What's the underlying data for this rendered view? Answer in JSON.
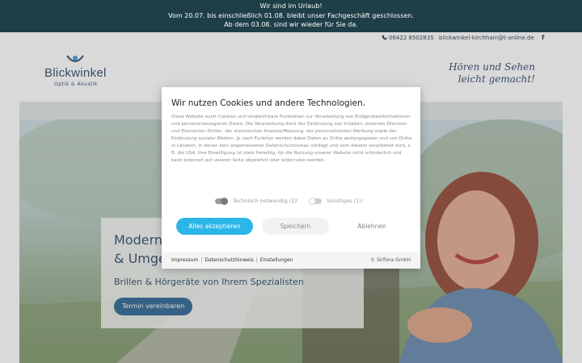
{
  "announcement": {
    "line1": "Wir sind im Urlaub!",
    "line2": "Vom 20.07. bis einschließlich 01.08. bleibt unser Fachgeschäft geschlossen.",
    "line3": "Ab dem 03.08. sind wir wieder für Sie da."
  },
  "contact": {
    "phone": "06422 8502835",
    "phone_icon": "phone-icon",
    "email": "blickwinkel-kirchhain@t-online.de",
    "facebook_icon": "facebook-icon",
    "facebook_glyph": "f"
  },
  "header": {
    "logo_title": "Blickwinkel",
    "logo_subtitle": "Optik & Akustik",
    "tagline_line1": "Hören und Sehen",
    "tagline_line2": "leicht gemacht!"
  },
  "hero": {
    "title_line1": "Moderns",
    "title_line2": "& Umge",
    "subtitle": "Brillen & Hörgeräte von Ihrem Spezialisten",
    "cta_label": "Termin vereinbaren"
  },
  "cookie_dialog": {
    "title": "Wir nutzen Cookies und andere Technologien.",
    "body": "Diese Website nutzt Cookies und vergleichbare Funktionen zur Verarbeitung von Endgeräteinformationen und personenbezogenen Daten. Die Verarbeitung dient der Einbindung von Inhalten, externen Diensten und Elementen Dritter, der statistischen Analyse/Messung, der personalisierten Werbung sowie der Einbindung sozialer Medien. Je nach Funktion werden dabei Daten an Dritte weitergegeben und von Dritte in Ländern, in denen kein angemessenes Datenschutzniveau vorliegt und vom diesem verarbeitet wird, z. B. die USA. Ihre Einwilligung ist stets freiwillig, für die Nutzung unserer Website nicht erforderlich und kann jederzeit auf unserer Seite abgelehnt oder widerrufen werden.",
    "toggle_necessary": {
      "label": "Technisch notwendig (1)",
      "help": "?",
      "on": true
    },
    "toggle_other": {
      "label": "Sonstiges (1)",
      "help": "?",
      "on": false
    },
    "accept_label": "Alles akzeptieren",
    "save_label": "Speichern",
    "deny_label": "Ablehnen",
    "footer_links": [
      "Impressum",
      "Datenschutzhinweis",
      "Einstellungen"
    ],
    "footer_sep": "|",
    "copyright": "© Sirfona GmbH",
    "accent_color": "#2cb5e8"
  },
  "colors": {
    "topbar": "#1e3f48",
    "brand_navy": "#1c3a5c",
    "cta_blue": "#1d5a8a"
  }
}
